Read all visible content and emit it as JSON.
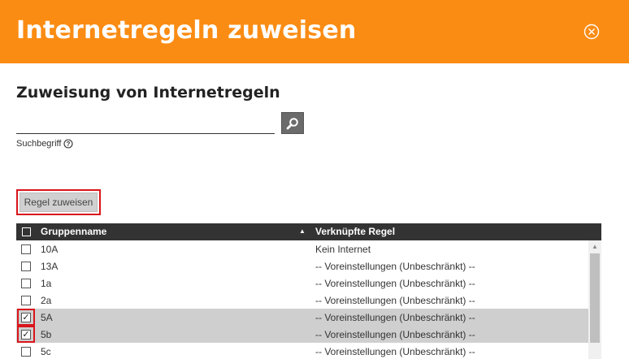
{
  "header": {
    "title": "Internetregeln zuweisen",
    "close_icon": "close-circle-icon",
    "color": "#fb8c13"
  },
  "section": {
    "title": "Zuweisung von Internetregeln"
  },
  "search": {
    "value": "",
    "placeholder": "",
    "button_icon": "search-icon",
    "label": "Suchbegriff",
    "help_icon": "help-circle-icon"
  },
  "actions": {
    "assign_label": "Regel zuweisen",
    "highlight_color": "#d9151b"
  },
  "table": {
    "columns": {
      "name": "Gruppenname",
      "rule": "Verknüpfte Regel"
    },
    "sort_column": "name",
    "sort_direction": "ascending",
    "rows": [
      {
        "name": "10A",
        "rule": "Kein Internet",
        "checked": false,
        "checked_mark": ""
      },
      {
        "name": "13A",
        "rule": "-- Voreinstellungen (Unbeschränkt) --",
        "checked": false,
        "checked_mark": ""
      },
      {
        "name": "1a",
        "rule": "-- Voreinstellungen (Unbeschränkt) --",
        "checked": false,
        "checked_mark": ""
      },
      {
        "name": "2a",
        "rule": "-- Voreinstellungen (Unbeschränkt) --",
        "checked": false,
        "checked_mark": ""
      },
      {
        "name": "5A",
        "rule": "-- Voreinstellungen (Unbeschränkt) --",
        "checked": true,
        "checked_mark": "✓"
      },
      {
        "name": "5b",
        "rule": "-- Voreinstellungen (Unbeschränkt) --",
        "checked": true,
        "checked_mark": "✓"
      },
      {
        "name": "5c",
        "rule": "-- Voreinstellungen (Unbeschränkt) --",
        "checked": false,
        "checked_mark": ""
      }
    ]
  }
}
